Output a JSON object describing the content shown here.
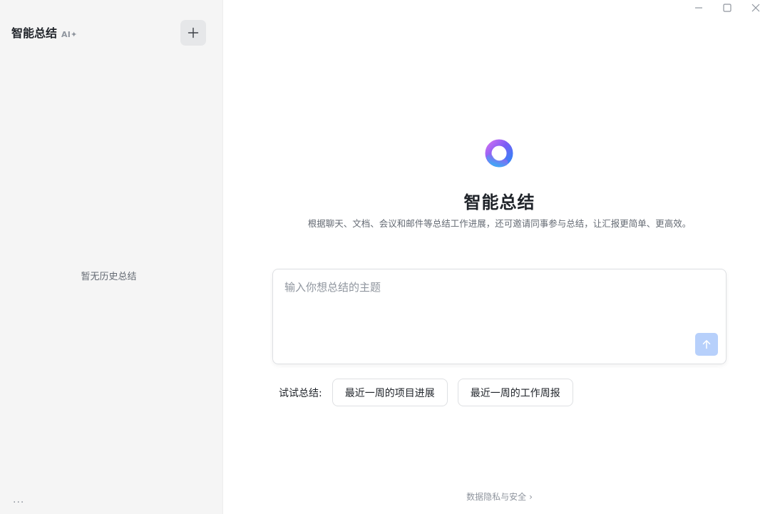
{
  "sidebar": {
    "title": "智能总结",
    "ai_badge": "AI✦",
    "new_button_icon": "plus-icon",
    "empty_text": "暂无历史总结",
    "more_icon": "···"
  },
  "window_controls": {
    "minimize_icon": "minimize-icon",
    "maximize_icon": "maximize-icon",
    "close_icon": "close-icon"
  },
  "main": {
    "logo_icon": "ai-ring-logo-icon",
    "title": "智能总结",
    "subtitle": "根据聊天、文档、会议和邮件等总结工作进展，还可邀请同事参与总结，让汇报更简单、更高效。",
    "input": {
      "placeholder": "输入你想总结的主题",
      "value": ""
    },
    "send_icon": "arrow-up-icon",
    "suggestions": {
      "label": "试试总结:",
      "items": [
        "最近一周的项目进展",
        "最近一周的工作周报"
      ]
    },
    "privacy_link": "数据隐私与安全",
    "privacy_chevron": "›"
  },
  "colors": {
    "sidebar_bg": "#f5f5f5",
    "send_button_disabled": "#b7d0fb",
    "text_primary": "#1f2329",
    "text_secondary": "#646a73"
  }
}
